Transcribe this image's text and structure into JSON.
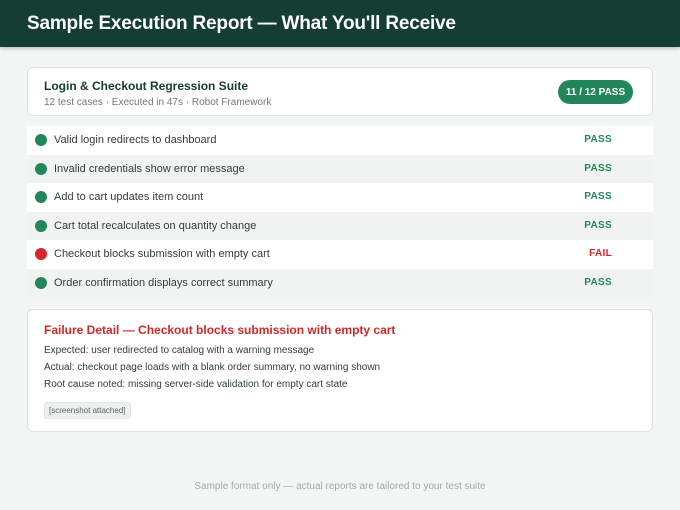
{
  "header": {
    "title": "Sample Execution Report — What You'll Receive"
  },
  "suite": {
    "title": "Login & Checkout Regression Suite",
    "meta": "12 test cases · Executed in 47s · Robot Framework",
    "badge": "11 / 12 PASS"
  },
  "tests": [
    {
      "name": "Valid login redirects to dashboard",
      "status": "PASS"
    },
    {
      "name": "Invalid credentials show error message",
      "status": "PASS"
    },
    {
      "name": "Add to cart updates item count",
      "status": "PASS"
    },
    {
      "name": "Cart total recalculates on quantity change",
      "status": "PASS"
    },
    {
      "name": "Checkout blocks submission with empty cart",
      "status": "FAIL"
    },
    {
      "name": "Order confirmation displays correct summary",
      "status": "PASS"
    }
  ],
  "failure": {
    "title": "Failure Detail — Checkout blocks submission with empty cart",
    "expected": "Expected: user redirected to catalog with a warning message",
    "actual": "Actual: checkout page loads with a blank order summary, no warning shown",
    "root_cause": "Root cause noted: missing server-side validation for empty cart state",
    "attachment": "[screenshot attached]"
  },
  "footer": {
    "note": "Sample format only — actual reports are tailored to your test suite"
  },
  "colors": {
    "header_bg": "#143d34",
    "pass": "#23865a",
    "fail": "#d7262b"
  },
  "icons": {
    "pass": "pass-status-dot-icon",
    "fail": "fail-status-dot-icon"
  }
}
